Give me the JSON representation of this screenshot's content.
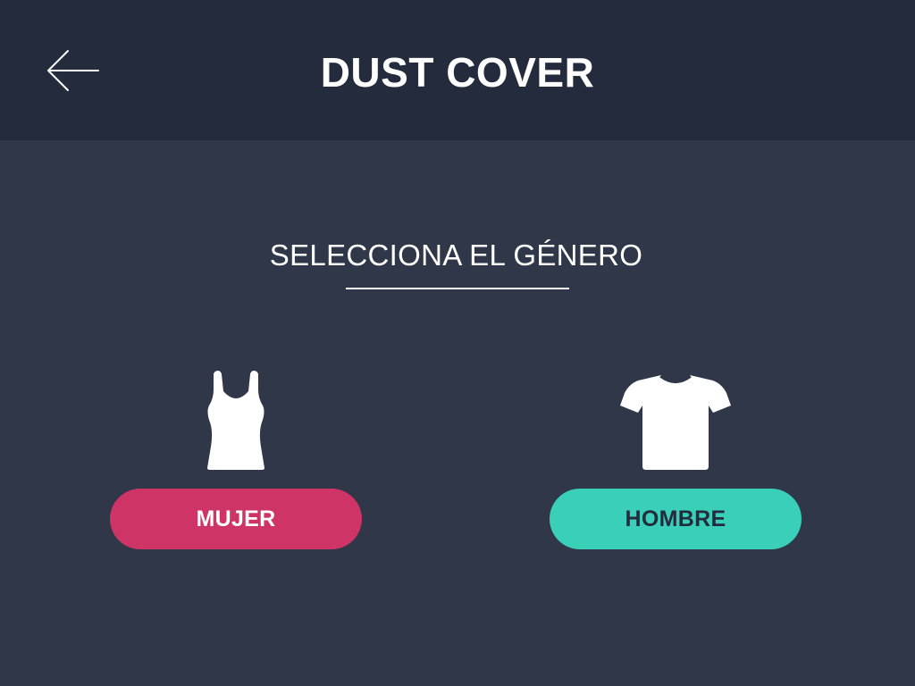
{
  "header": {
    "title": "DUST COVER",
    "back_icon": "arrow-left-icon"
  },
  "main": {
    "prompt": "SELECCIONA EL GÉNERO",
    "options": [
      {
        "label": "MUJER",
        "icon": "tank-top-icon",
        "color": "#cf3466",
        "text_color": "#ffffff"
      },
      {
        "label": "HOMBRE",
        "icon": "t-shirt-icon",
        "color": "#3acfb9",
        "text_color": "#232b3d"
      }
    ]
  },
  "colors": {
    "header_bg": "#232b3d",
    "page_bg": "#2f3748",
    "text": "#ffffff"
  }
}
